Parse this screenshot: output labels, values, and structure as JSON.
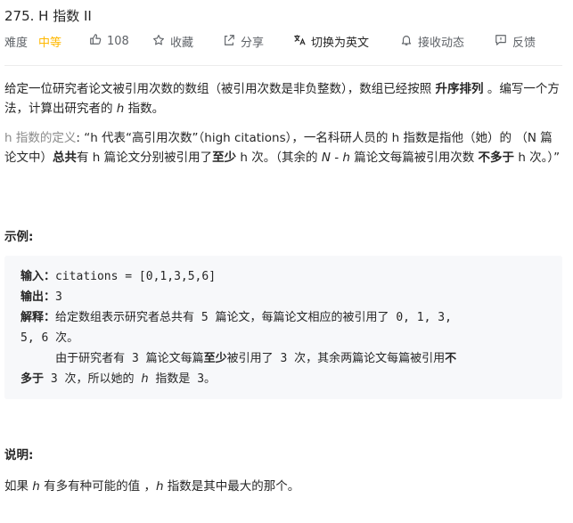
{
  "problem": {
    "title": "275. H 指数 II"
  },
  "meta": {
    "difficulty_label": "难度",
    "difficulty_value": "中等",
    "difficulty_color": "#ffb800",
    "likes": "108",
    "favorite_label": "收藏",
    "share_label": "分享",
    "translate_label": "切换为英文",
    "notify_label": "接收动态",
    "feedback_label": "反馈"
  },
  "description": {
    "p1_a": "给定一位研究者论文被引用次数的数组（被引用次数是非负整数），数组已经按照 ",
    "p1_b": "升序排列",
    "p1_c": " 。编写一个方法，计算出研究者的 ",
    "p1_h": "h",
    "p1_d": " 指数。",
    "p2_a": "h 指数的定义",
    "p2_b": ": “h 代表“高引用次数”（high citations），一名科研人员的 h 指数是指他（她）的 （N 篇论文中）",
    "p2_c": "总共",
    "p2_d": "有 h 篇论文分别被引用了",
    "p2_e": "至少",
    "p2_f": " h 次。（其余的 ",
    "p2_g": "N - h",
    "p2_h": " 篇论文每篇被引用次数 ",
    "p2_i": "不多于",
    "p2_j": " h 次。）”"
  },
  "example": {
    "heading": "示例:",
    "input_label": "输入：",
    "input_value": "citations = [0,1,3,5,6]",
    "output_label": "输出：",
    "output_value": "3",
    "explain_label": "解释：",
    "explain_1": "给定数组表示研究者总共有 5 篇论文，每篇论文相应的被引用了 0, 1, 3, ",
    "explain_2": "5, 6 次。",
    "explain_3a": "     由于研究者有 3 篇论文每篇",
    "explain_3b": "至少",
    "explain_3c": "被引用了 3 次，其余两篇论文每篇被引用",
    "explain_3d": "不",
    "explain_4a": "多于",
    "explain_4b": " 3 次，所以她的 ",
    "explain_4c": "h",
    "explain_4d": " 指数是 3。"
  },
  "notes": {
    "heading": "说明:",
    "text_a": "如果 ",
    "text_h1": "h",
    "text_b": " 有多有种可能的值 ，",
    "text_h2": "h",
    "text_c": " 指数是其中最大的那个。"
  }
}
